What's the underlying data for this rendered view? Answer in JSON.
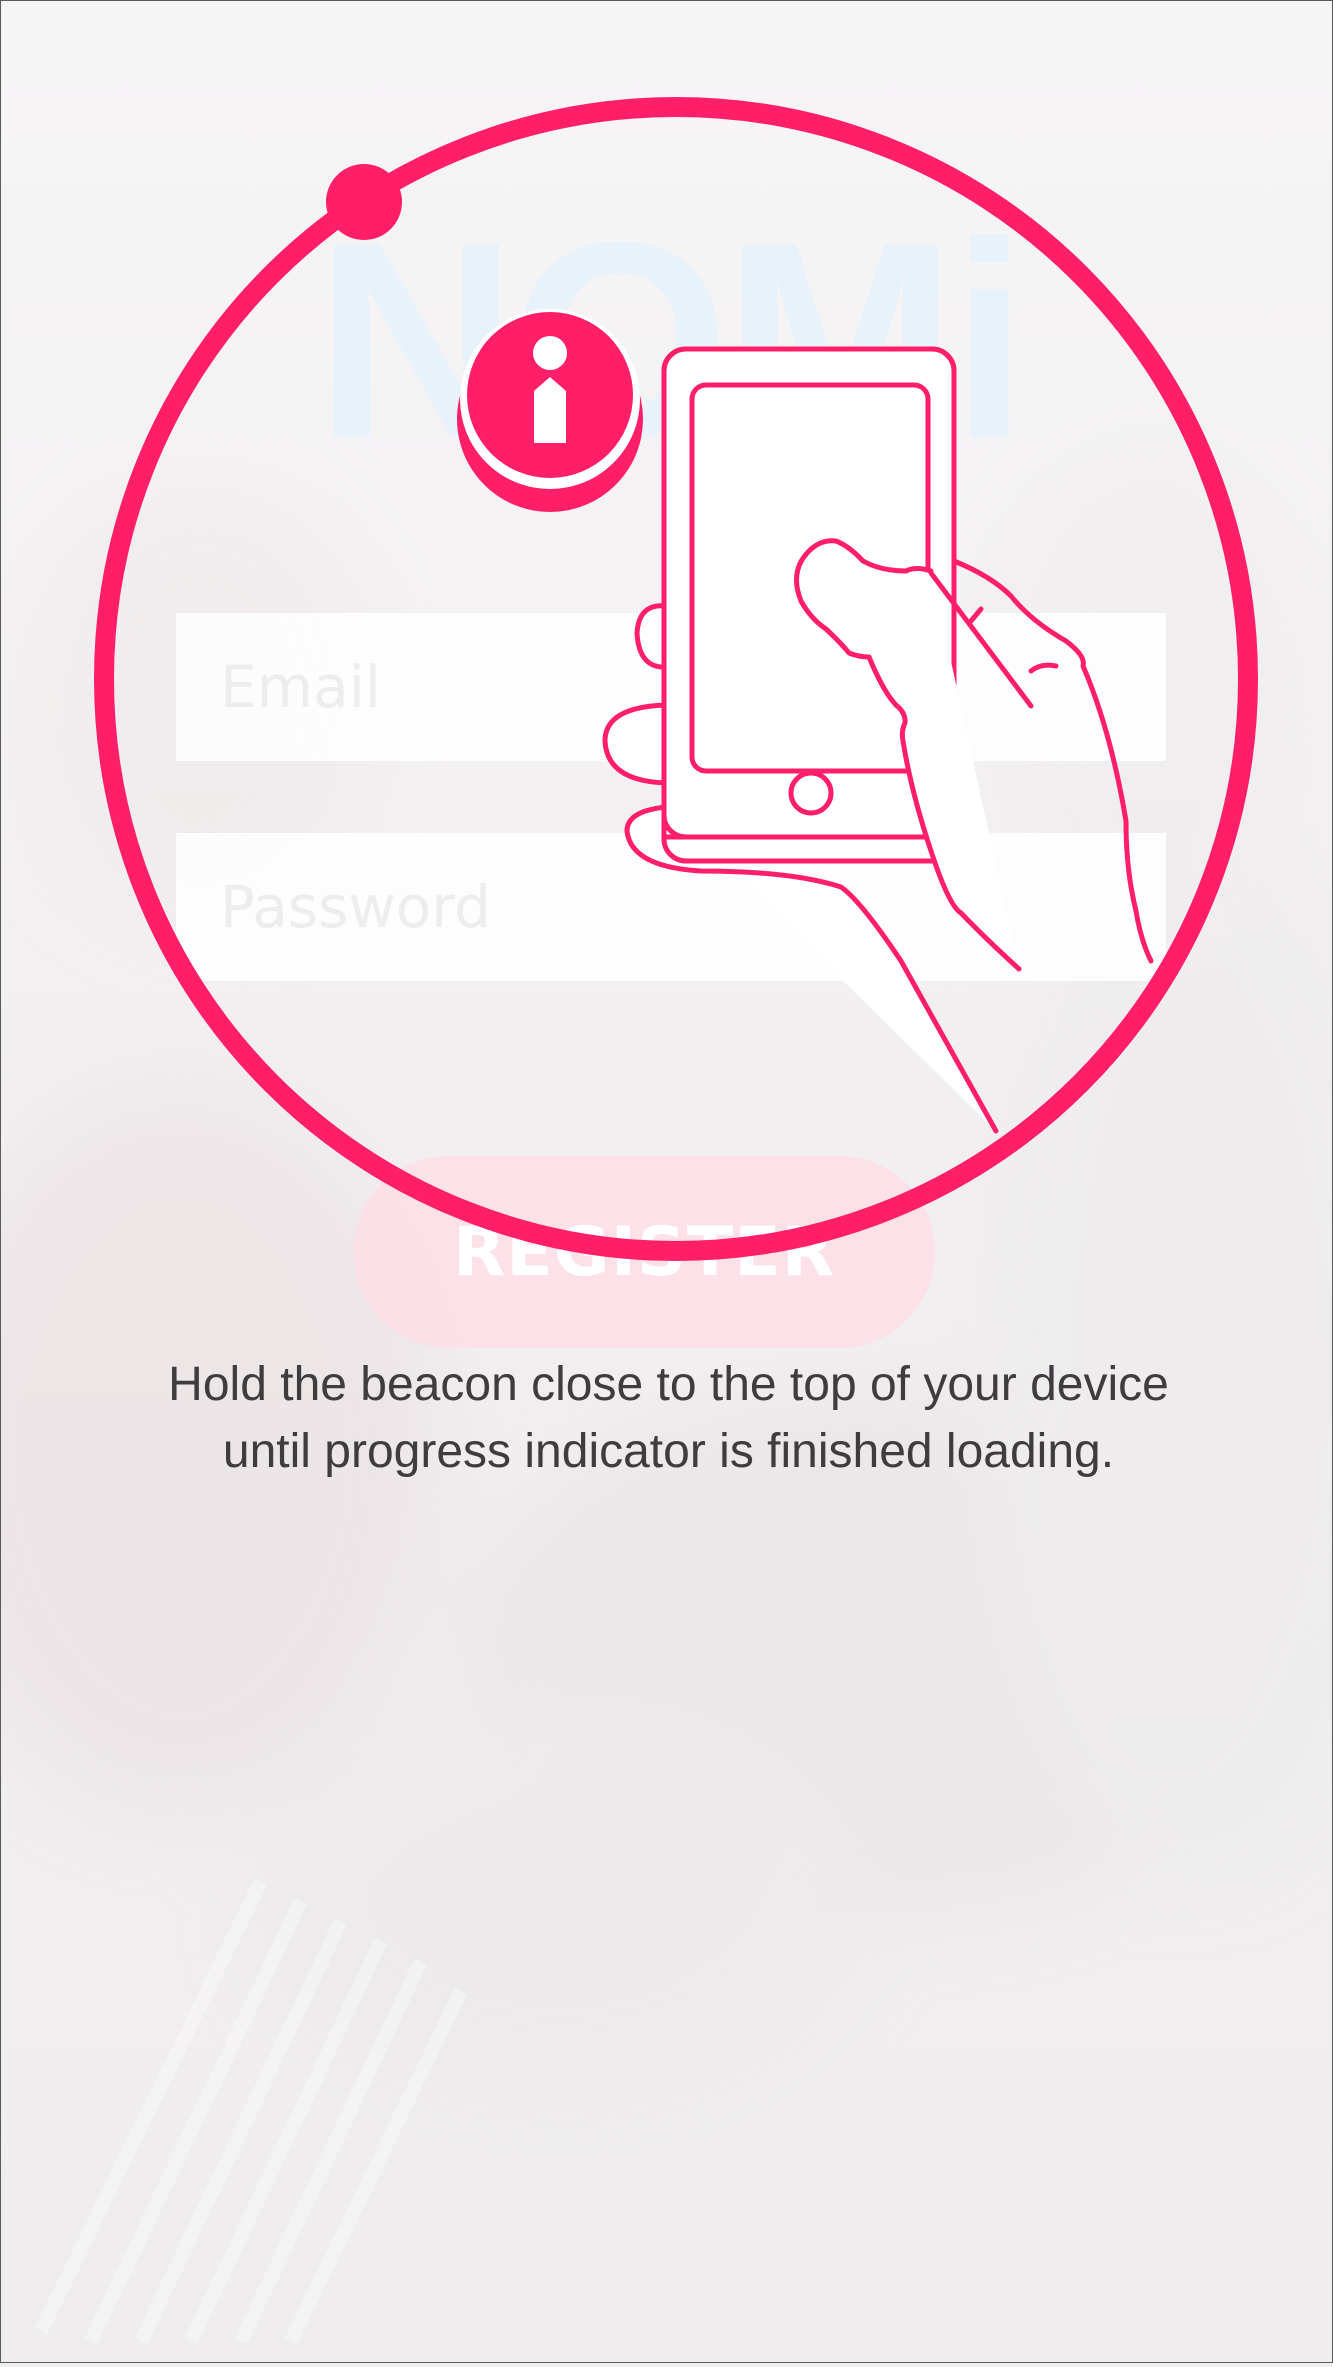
{
  "login": {
    "logo_text": "NOMi",
    "email_placeholder": "Email",
    "password_placeholder": "Password",
    "register_label": "REGISTER"
  },
  "beacon_prompt": {
    "line1": "Hold the beacon close to the top of your device",
    "line2": "until progress indicator is finished loading."
  },
  "icons": {
    "info": "info-icon",
    "phone_hand": "hand-holding-phone-icon",
    "progress": "progress-ring"
  },
  "colors": {
    "accent": "#ff1f68",
    "text": "#3e3c3e",
    "logo": "#e8f2fb"
  }
}
